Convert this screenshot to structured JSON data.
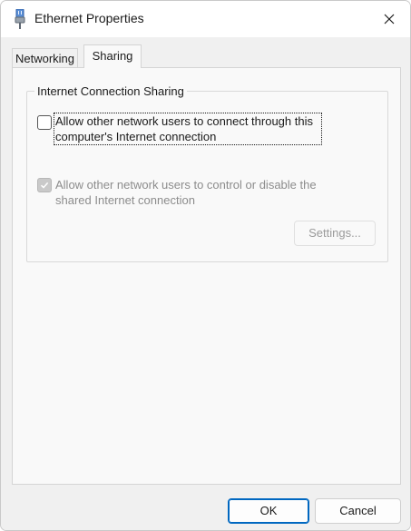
{
  "window": {
    "title": "Ethernet Properties",
    "icon": "ethernet-plug-icon",
    "close_icon": "close-icon"
  },
  "tabs": [
    {
      "label": "Networking",
      "selected": false
    },
    {
      "label": "Sharing",
      "selected": true
    }
  ],
  "sharing": {
    "group_label": "Internet Connection Sharing",
    "allow_connect": {
      "label": "Allow other network users to connect through this computer's Internet connection",
      "checked": false,
      "enabled": true
    },
    "allow_control": {
      "label": "Allow other network users to control or disable the shared Internet connection",
      "checked": true,
      "enabled": false
    },
    "settings_button": "Settings..."
  },
  "footer": {
    "ok_label": "OK",
    "cancel_label": "Cancel"
  },
  "colors": {
    "accent": "#0067c0",
    "dialog_bg": "#f0f0f0",
    "panel_bg": "#f9f9f9"
  }
}
